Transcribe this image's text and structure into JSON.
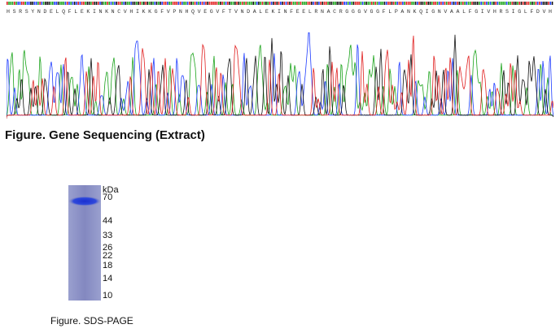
{
  "sequence_figure": {
    "caption": "Figure. Gene Sequencing (Extract)",
    "amino_acids": "H S R S Y N D E L Q F L E K I N K N C V H I K K G F V P N H Q V E G V F T V N D A L E K I N F E E L R N A C R G G G V G G F L P A N K Q I G N V A A L F G I V H R S I G L F D V H",
    "base_colors": {
      "A": "#1aa31a",
      "C": "#1e3cff",
      "G": "#111111",
      "T": "#e01e1e"
    }
  },
  "gel_figure": {
    "caption": "Figure. SDS-PAGE",
    "unit_label": "kDa",
    "markers": [
      {
        "label": "70",
        "kda": 70
      },
      {
        "label": "44",
        "kda": 44
      },
      {
        "label": "33",
        "kda": 33
      },
      {
        "label": "26",
        "kda": 26
      },
      {
        "label": "22",
        "kda": 22
      },
      {
        "label": "18",
        "kda": 18
      },
      {
        "label": "14",
        "kda": 14
      },
      {
        "label": "10",
        "kda": 10
      }
    ],
    "lane_color": "#8a8fc4",
    "band_color": "#1f3bd6",
    "band_kda": 66
  }
}
